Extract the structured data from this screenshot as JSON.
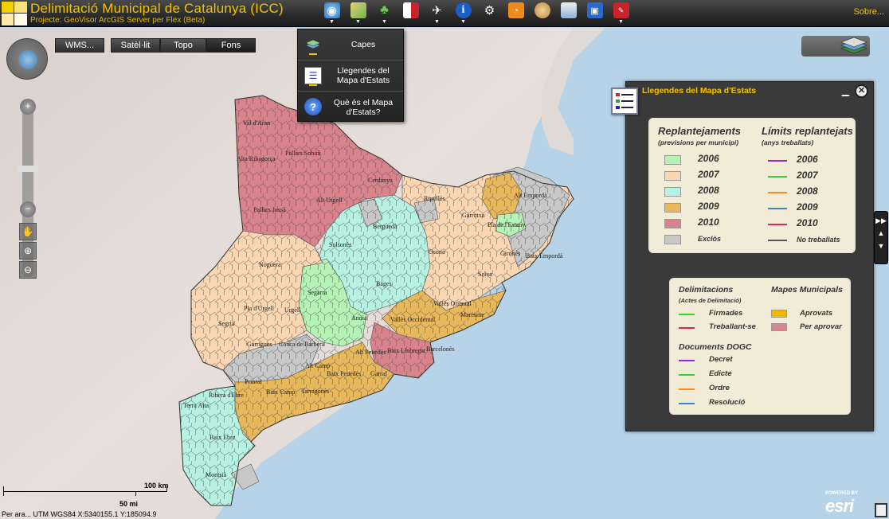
{
  "header": {
    "title": "Delimitació Municipal de Catalunya (ICC)",
    "subtitle": "Projecte: GeoVisor ArcGIS Server per Flex (Beta)",
    "about": "Sobre...",
    "toolbar_icons": [
      "layers-globe-icon",
      "map-icon",
      "tree-icon",
      "book-icon",
      "pin-icon",
      "info-icon",
      "camera-icon",
      "rss-icon",
      "palette-icon",
      "printer-icon",
      "save-icon",
      "pdf-icon"
    ]
  },
  "dropdown": {
    "items": [
      {
        "label": "Capes",
        "icon": "layers-icon"
      },
      {
        "label": "Llegendes del Mapa d'Estats",
        "icon": "legend-icon"
      },
      {
        "label": "Què és el Mapa d'Estats?",
        "icon": "help-icon"
      }
    ]
  },
  "basemaps": {
    "wms": "WMS...",
    "satellite": "Satèl·lit",
    "topo": "Topo",
    "fons": "Fons"
  },
  "legend_panel": {
    "title": "Llegendes del Mapa d'Estats",
    "card1": {
      "left_title": "Replantejaments",
      "left_sub": "(previsions per municipi)",
      "right_title": "Límits replantejats",
      "right_sub": "(anys treballats)",
      "fills": [
        {
          "label": "2006",
          "color": "#b5f2b5"
        },
        {
          "label": "2007",
          "color": "#fbd6b2"
        },
        {
          "label": "2008",
          "color": "#b6f1e2"
        },
        {
          "label": "2009",
          "color": "#e8b85c"
        },
        {
          "label": "2010",
          "color": "#d9838d"
        },
        {
          "label": "Exclòs",
          "color": "#c8c8c8"
        }
      ],
      "lines": [
        {
          "label": "2006",
          "color": "#8a2be2"
        },
        {
          "label": "2007",
          "color": "#2ed82e"
        },
        {
          "label": "2008",
          "color": "#ff8c1a"
        },
        {
          "label": "2009",
          "color": "#3b7fd9"
        },
        {
          "label": "2010",
          "color": "#e0245e"
        },
        {
          "label": "No treballats",
          "color": "#555555"
        }
      ]
    },
    "card2": {
      "delim_title": "Delimitacions",
      "delim_sub": "(Actes de Delimitació)",
      "delim_items": [
        {
          "label": "Firmades",
          "color": "#2ed82e"
        },
        {
          "label": "Treballant-se",
          "color": "#e0245e"
        }
      ],
      "mapes_title": "Mapes Municipals",
      "mapes_items": [
        {
          "label": "Aprovats",
          "color": "#f0b800"
        },
        {
          "label": "Per aprovar",
          "color": "#d9838d"
        }
      ],
      "dogc_title": "Documents DOGC",
      "dogc_items": [
        {
          "label": "Decret",
          "color": "#8a2be2"
        },
        {
          "label": "Edicte",
          "color": "#2ed82e"
        },
        {
          "label": "Ordre",
          "color": "#ff8c1a"
        },
        {
          "label": "Resolució",
          "color": "#3b7fd9"
        }
      ]
    }
  },
  "map": {
    "labels": [
      {
        "text": "Val d'Aran"
      },
      {
        "text": "Pallars Sobirà"
      },
      {
        "text": "Alta Ribagorça"
      },
      {
        "text": "Cerdanya"
      },
      {
        "text": "Alt Urgell"
      },
      {
        "text": "Pallars Jussà"
      },
      {
        "text": "Ripollès"
      },
      {
        "text": "Alt Empordà"
      },
      {
        "text": "Garrotxa"
      },
      {
        "text": "Pla de l'Estany"
      },
      {
        "text": "Berguedà"
      },
      {
        "text": "Solsonès"
      },
      {
        "text": "Osona"
      },
      {
        "text": "Gironès"
      },
      {
        "text": "Baix Empordà"
      },
      {
        "text": "Noguera"
      },
      {
        "text": "Selva"
      },
      {
        "text": "Bages"
      },
      {
        "text": "Segarra"
      },
      {
        "text": "Pla d'Urgell"
      },
      {
        "text": "Urgell"
      },
      {
        "text": "Vallès Oriental"
      },
      {
        "text": "Maresme"
      },
      {
        "text": "Segrià"
      },
      {
        "text": "Anoia"
      },
      {
        "text": "Vallès Occidental"
      },
      {
        "text": "Garrigues"
      },
      {
        "text": "Conca de Barberà"
      },
      {
        "text": "Alt Penedès"
      },
      {
        "text": "Baix Llobregat"
      },
      {
        "text": "Barcelonès"
      },
      {
        "text": "Alt Camp"
      },
      {
        "text": "Baix Penedès"
      },
      {
        "text": "Garraf"
      },
      {
        "text": "Priorat"
      },
      {
        "text": "Baix Camp"
      },
      {
        "text": "Tarragonès"
      },
      {
        "text": "Ribera d'Ebre"
      },
      {
        "text": "Terra Alta"
      },
      {
        "text": "Baix Ebre"
      },
      {
        "text": "Montsià"
      }
    ],
    "scale_km": "100 km",
    "scale_mi": "50 mi",
    "coords": "Per ara... UTM WGS84 X:5340155.1   Y:185094.9",
    "powered_by": "POWERED BY",
    "esri": "esri"
  },
  "side_buttons": [
    "▶▶",
    "▲",
    "▼"
  ]
}
